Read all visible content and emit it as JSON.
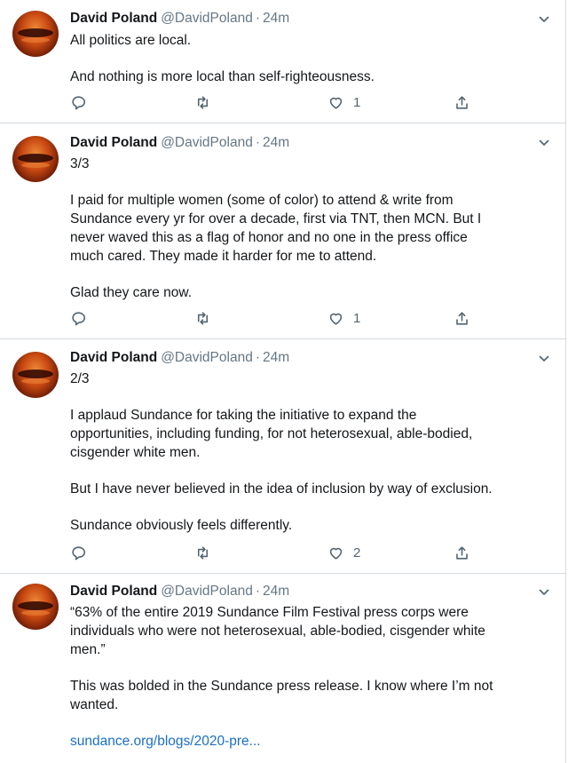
{
  "tweets": [
    {
      "name": "David Poland",
      "handle": "@DavidPoland",
      "time": "24m",
      "lines": [
        "All politics are local.",
        "",
        "And nothing is more local than self-righteousness."
      ],
      "likes": "1"
    },
    {
      "name": "David Poland",
      "handle": "@DavidPoland",
      "time": "24m",
      "lines": [
        "3/3",
        "",
        "I paid for multiple women (some of color) to attend & write from",
        "Sundance every yr for over a decade, first via TNT, then MCN. But I",
        "never waved this as a flag of honor and no one in the press office",
        "much cared. They made it harder for me to attend.",
        "",
        "Glad they care now."
      ],
      "likes": "1"
    },
    {
      "name": "David Poland",
      "handle": "@DavidPoland",
      "time": "24m",
      "lines": [
        "2/3",
        "",
        "I applaud Sundance for taking the initiative to expand the",
        "opportunities, including funding, for not heterosexual, able-bodied,",
        "cisgender white men.",
        "",
        "But I have never believed in the idea of inclusion by way of exclusion.",
        "",
        "Sundance obviously feels differently."
      ],
      "likes": "2"
    },
    {
      "name": "David Poland",
      "handle": "@DavidPoland",
      "time": "24m",
      "lines": [
        "“63% of the entire 2019 Sundance Film Festival press corps were",
        "individuals who were not heterosexual, able-bodied, cisgender white",
        "men.”",
        "",
        "This was bolded in the Sundance press release. I know where I’m not",
        "wanted."
      ],
      "link": "sundance.org/blogs/2020-pre..."
    }
  ],
  "separator": "·"
}
